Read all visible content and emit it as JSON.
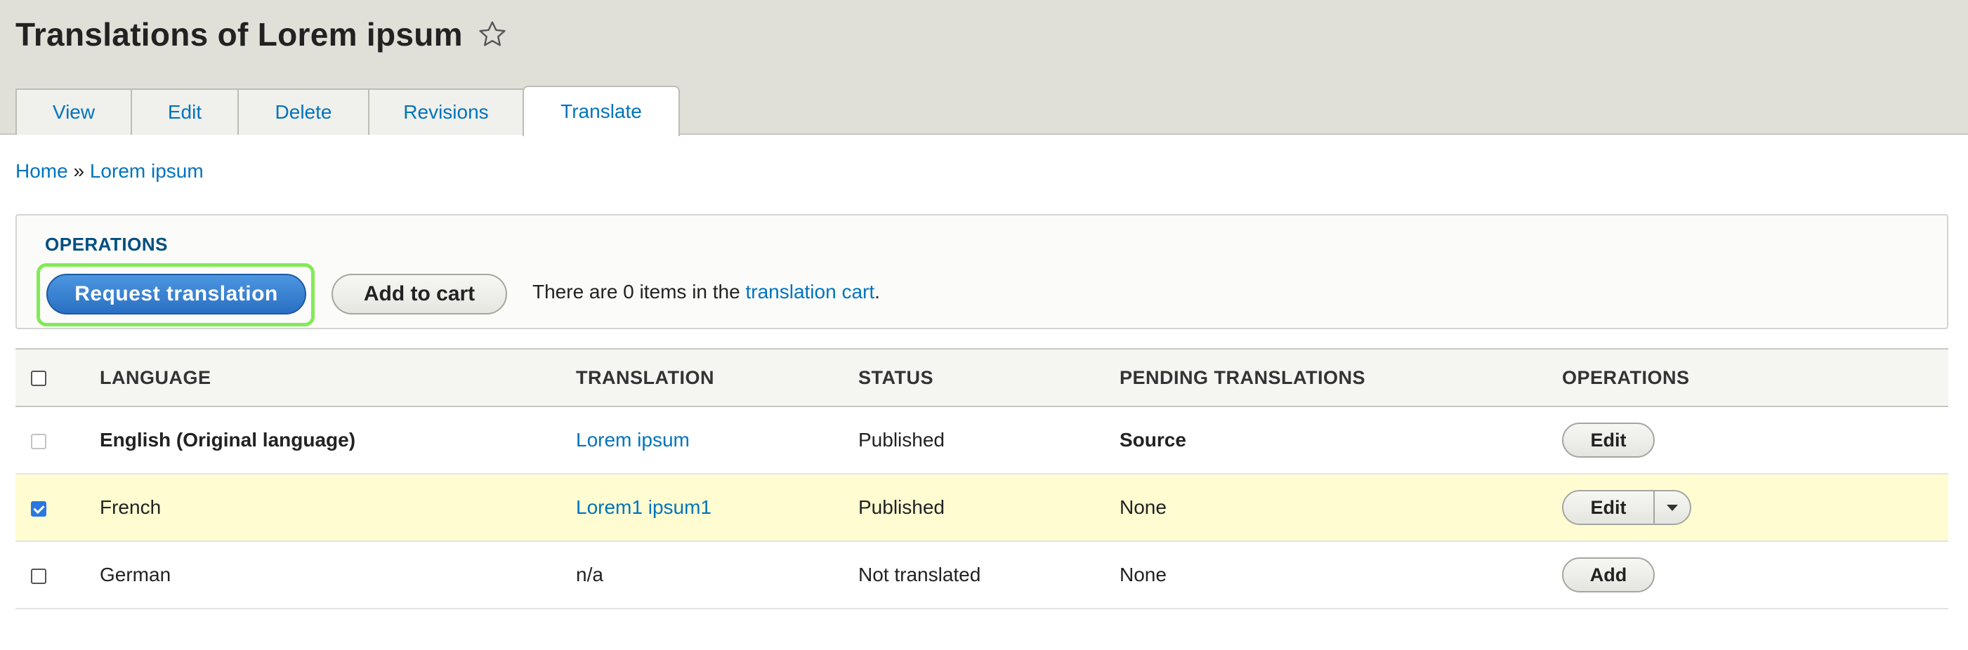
{
  "page": {
    "title": "Translations of Lorem ipsum",
    "star_icon": "star-outline-icon"
  },
  "tabs": [
    {
      "label": "View",
      "active": false
    },
    {
      "label": "Edit",
      "active": false
    },
    {
      "label": "Delete",
      "active": false
    },
    {
      "label": "Revisions",
      "active": false
    },
    {
      "label": "Translate",
      "active": true
    }
  ],
  "breadcrumb": {
    "home": "Home",
    "separator": "»",
    "current": "Lorem ipsum"
  },
  "operations": {
    "title": "OPERATIONS",
    "request_button": "Request translation",
    "cart_button": "Add to cart",
    "cart_text_before": "There are 0 items in the",
    "cart_link": "translation cart",
    "cart_text_after": "."
  },
  "table": {
    "headers": [
      "LANGUAGE",
      "TRANSLATION",
      "STATUS",
      "PENDING TRANSLATIONS",
      "OPERATIONS"
    ],
    "rows": [
      {
        "language": "English (Original language)",
        "translation": "Lorem ipsum",
        "status": "Published",
        "pending": "Source",
        "operation": "Edit",
        "checked": false,
        "disabled": true
      },
      {
        "language": "French",
        "translation": "Lorem1 ipsum1",
        "status": "Published",
        "pending": "None",
        "operation": "Edit",
        "checked": true,
        "disabled": false
      },
      {
        "language": "German",
        "translation": "n/a",
        "status": "Not translated",
        "pending": "None",
        "operation": "Add",
        "checked": false,
        "disabled": false
      }
    ]
  },
  "colors": {
    "link": "#0074bd",
    "primary_button": "#2a70c4",
    "focus_ring": "#82ea55",
    "selected_row": "#fffcd2",
    "header_bg": "#e0dfd8"
  }
}
